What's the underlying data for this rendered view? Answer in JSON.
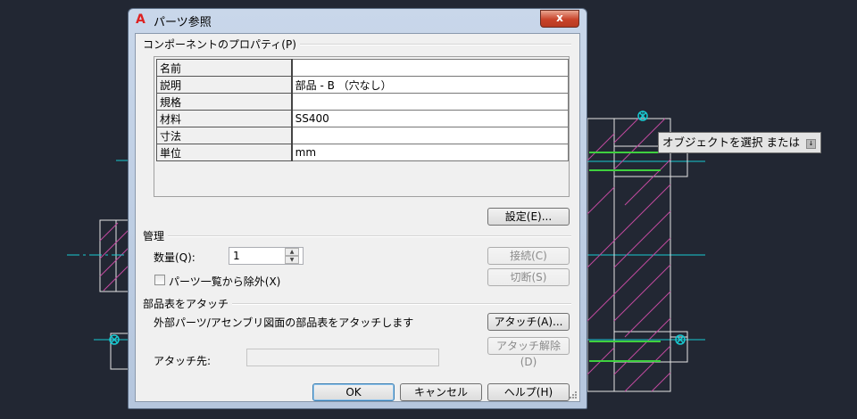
{
  "tooltip": {
    "text": "オブジェクトを選択 または"
  },
  "dialog": {
    "title": "パーツ参照",
    "close_label": "x",
    "properties_group": "コンポーネントのプロパティ(P)",
    "properties": [
      {
        "key": "名前",
        "value": ""
      },
      {
        "key": "説明",
        "value": "部品 - B （穴なし）"
      },
      {
        "key": "規格",
        "value": ""
      },
      {
        "key": "材料",
        "value": "SS400"
      },
      {
        "key": "寸法",
        "value": ""
      },
      {
        "key": "単位",
        "value": "mm"
      }
    ],
    "settings_button": "設定(E)...",
    "management_group": "管理",
    "quantity_label": "数量(Q):",
    "quantity_value": "1",
    "connect_button": "接続(C)",
    "disconnect_button": "切断(S)",
    "exclude_checkbox_label": "パーツ一覧から除外(X)",
    "exclude_checked": false,
    "attach_group": "部品表をアタッチ",
    "attach_description": "外部パーツ/アセンブリ図面の部品表をアタッチします",
    "attach_button": "アタッチ(A)...",
    "detach_button": "アタッチ解除(D)",
    "attach_to_label": "アタッチ先:",
    "attach_to_value": "",
    "ok_button": "OK",
    "cancel_button": "キャンセル",
    "help_button": "ヘルプ(H)"
  },
  "colors": {
    "canvas_background": "#222733",
    "cad_white": "#e6e6e6",
    "cad_cyan": "#18c8d0",
    "cad_magenta": "#c24aa0",
    "cad_green": "#3fd03f"
  }
}
